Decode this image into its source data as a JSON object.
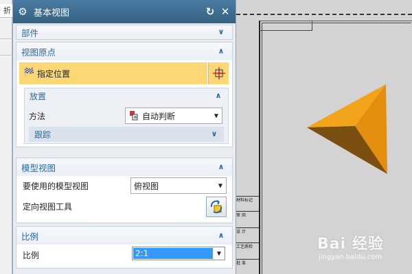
{
  "left_strip": {
    "corner_text": "折"
  },
  "dialog": {
    "title": "基本视图",
    "icons": {
      "gear": "gear-icon",
      "reset": "reset-icon",
      "close": "close-icon"
    }
  },
  "sections": {
    "part": {
      "title": "部件",
      "state": "collapsed"
    },
    "view_origin": {
      "title": "视图原点",
      "specify_label": "指定位置",
      "placement": {
        "title": "放置",
        "method_label": "方法",
        "method_value": "自动判断",
        "tracking_title": "跟踪"
      }
    },
    "model_view": {
      "title": "模型视图",
      "use_label": "要使用的模型视图",
      "use_value": "俯视图",
      "orient_label": "定向视图工具"
    },
    "scale": {
      "title": "比例",
      "label": "比例",
      "value": "2:1"
    }
  },
  "drawing": {
    "title_block_rows": [
      "材料标记",
      "审 阅",
      "设 计",
      "工艺质检",
      "批 准"
    ]
  },
  "watermark": {
    "main": "Bai 经验",
    "sub": "jingyan.baidu.com"
  },
  "colors": {
    "titlebar": "#3a6a8e",
    "accent": "#2d6b9a",
    "highlight": "#fbd775",
    "selection": "#3399ff",
    "pyramid_top": "#f2a51a",
    "pyramid_right": "#e38e0f",
    "pyramid_bottom": "#7a4f10"
  }
}
